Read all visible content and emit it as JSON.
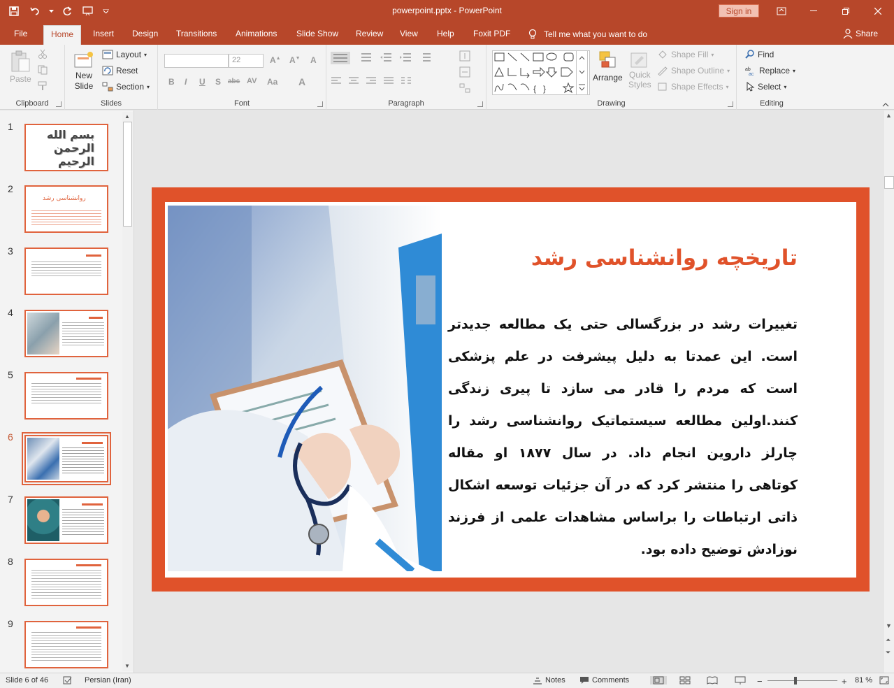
{
  "titlebar": {
    "title": "powerpoint.pptx  -  PowerPoint",
    "signin": "Sign in",
    "bg_color": "#b7472a"
  },
  "tabs": [
    "File",
    "Home",
    "Insert",
    "Design",
    "Transitions",
    "Animations",
    "Slide Show",
    "Review",
    "View",
    "Help",
    "Foxit PDF"
  ],
  "active_tab": "Home",
  "tellme": "Tell me what you want to do",
  "share": "Share",
  "ribbon": {
    "clipboard": {
      "paste": "Paste",
      "label": "Clipboard"
    },
    "slides": {
      "new_slide_1": "New",
      "new_slide_2": "Slide",
      "layout": "Layout",
      "reset": "Reset",
      "section": "Section",
      "label": "Slides"
    },
    "font": {
      "size": "22",
      "label": "Font",
      "bold": "B",
      "italic": "I",
      "underline": "U",
      "shadow": "S",
      "strike": "abc",
      "spacing": "AV",
      "case": "Aa",
      "color": "A"
    },
    "paragraph": {
      "label": "Paragraph"
    },
    "drawing": {
      "arrange": "Arrange",
      "quick_1": "Quick",
      "quick_2": "Styles",
      "shape_fill": "Shape Fill",
      "shape_outline": "Shape Outline",
      "shape_effects": "Shape Effects",
      "label": "Drawing"
    },
    "editing": {
      "find": "Find",
      "replace": "Replace",
      "select": "Select",
      "label": "Editing"
    }
  },
  "thumbnails": [
    {
      "num": "1",
      "title": "بسم الله الرحمن الرحیم"
    },
    {
      "num": "2",
      "title": "روانشناسی رشد"
    },
    {
      "num": "3"
    },
    {
      "num": "4"
    },
    {
      "num": "5"
    },
    {
      "num": "6",
      "active": true
    },
    {
      "num": "7"
    },
    {
      "num": "8"
    },
    {
      "num": "9"
    }
  ],
  "slide": {
    "title": "تاریخچه روانشناسی رشد",
    "body": "تغییرات رشد در بزرگسالی حتی یک مطالعه جدیدتر است. این عمدتا به دلیل پیشرفت در علم پزشکی است که مردم را قادر می سازد تا پیری زندگی کنند.اولین مطالعه سیستماتیک روانشناسی رشد را چارلز داروین انجام داد. در سال ۱۸۷۷ او مقاله کوتاهی را منتشر کرد که در آن جزئیات توسعه اشکال ذاتی ارتباطات را براساس مشاهدات علمی از فرزند نوزادش توضیح داده بود.",
    "accent_color": "#e0522a"
  },
  "statusbar": {
    "slide_info": "Slide 6 of 46",
    "language": "Persian (Iran)",
    "notes": "Notes",
    "comments": "Comments",
    "zoom": "81 %"
  }
}
